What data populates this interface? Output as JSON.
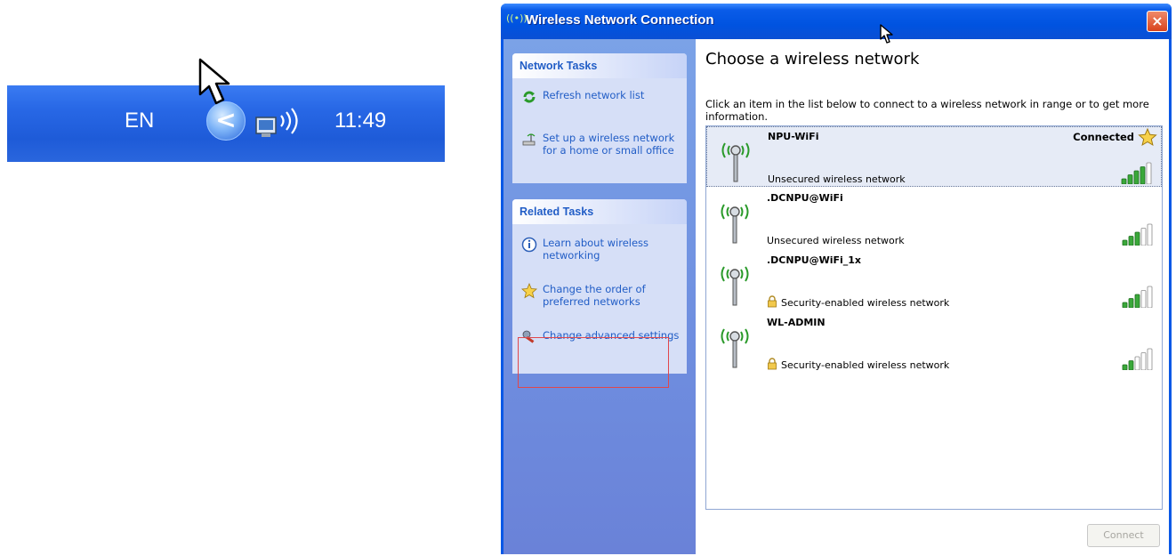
{
  "tray": {
    "language": "EN",
    "chevron": "<",
    "time": "11:49",
    "network_icon": "wireless-network-tray-icon"
  },
  "window": {
    "title": "Wireless Network Connection",
    "close": "×"
  },
  "sidebar": {
    "network_tasks": {
      "heading": "Network Tasks",
      "items": [
        {
          "label": "Refresh network list",
          "icon": "refresh-icon"
        },
        {
          "label": "Set up a wireless network for a home or small office",
          "icon": "setup-network-icon"
        }
      ]
    },
    "related_tasks": {
      "heading": "Related Tasks",
      "items": [
        {
          "label": "Learn about wireless networking",
          "icon": "info-icon"
        },
        {
          "label": "Change the order of preferred networks",
          "icon": "star-icon"
        },
        {
          "label": "Change advanced settings",
          "icon": "settings-icon"
        }
      ]
    }
  },
  "main": {
    "heading": "Choose a wireless network",
    "description": "Click an item in the list below to connect to a wireless network in range or to get more information.",
    "networks": [
      {
        "name": "NPU-WiFi",
        "security": "Unsecured wireless network",
        "status": "Connected",
        "signal": 4,
        "secured": false
      },
      {
        "name": ".DCNPU@WiFi",
        "security": "Unsecured wireless network",
        "status": "",
        "signal": 3,
        "secured": false
      },
      {
        "name": ".DCNPU@WiFi_1x",
        "security": "Security-enabled wireless network",
        "status": "",
        "signal": 3,
        "secured": true
      },
      {
        "name": "WL-ADMIN",
        "security": "Security-enabled wireless network",
        "status": "",
        "signal": 2,
        "secured": true
      }
    ],
    "connect_label": "Connect"
  },
  "colors": {
    "title_blue": "#0053e0",
    "task_link": "#215dc6",
    "signal_green": "#3aa83a",
    "highlight_red": "#e0474c"
  }
}
